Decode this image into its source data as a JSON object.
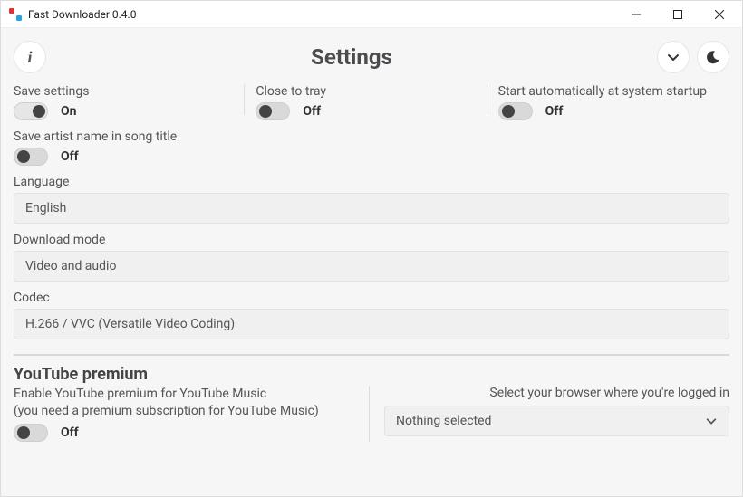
{
  "window": {
    "title": "Fast Downloader 0.4.0"
  },
  "header": {
    "title": "Settings"
  },
  "toggles": {
    "save_settings": {
      "label": "Save settings",
      "state": "On",
      "on": true
    },
    "close_to_tray": {
      "label": "Close to tray",
      "state": "Off",
      "on": false
    },
    "autostart": {
      "label": "Start automatically at system startup",
      "state": "Off",
      "on": false
    },
    "save_artist": {
      "label": "Save artist name in song title",
      "state": "Off",
      "on": false
    }
  },
  "language": {
    "label": "Language",
    "value": "English"
  },
  "download_mode": {
    "label": "Download mode",
    "value": "Video and audio"
  },
  "codec": {
    "label": "Codec",
    "value": "H.266 / VVC (Versatile Video Coding)"
  },
  "youtube": {
    "section_title": "YouTube premium",
    "enable_line1": "Enable YouTube premium for YouTube Music",
    "enable_line2": "(you need a premium subscription for YouTube Music)",
    "toggle": {
      "state": "Off",
      "on": false
    },
    "browser_label": "Select your browser where you're logged in",
    "browser_value": "Nothing selected"
  }
}
